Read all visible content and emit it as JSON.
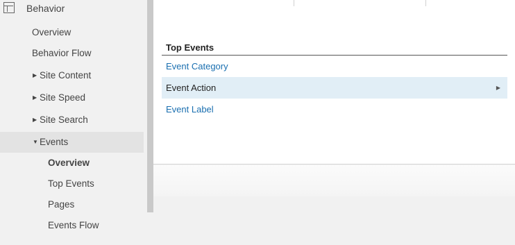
{
  "sidebar": {
    "section_title": "Behavior",
    "items": [
      {
        "label": "Overview"
      },
      {
        "label": "Behavior Flow"
      },
      {
        "label": "Site Content"
      },
      {
        "label": "Site Speed"
      },
      {
        "label": "Site Search"
      },
      {
        "label": "Events"
      }
    ],
    "events_subitems": [
      {
        "label": "Overview"
      },
      {
        "label": "Top Events"
      },
      {
        "label": "Pages"
      },
      {
        "label": "Events Flow"
      }
    ]
  },
  "main": {
    "table_title": "Top Events",
    "rows": [
      {
        "label": "Event Category"
      },
      {
        "label": "Event Action"
      },
      {
        "label": "Event Label"
      }
    ]
  },
  "colors": {
    "link": "#1a6fb0",
    "selected_row": "#e1eef6",
    "selected_nav": "#e3e3e3"
  },
  "icons": {
    "section": "layout-icon",
    "collapsed": "triangle-right-icon",
    "expanded": "triangle-down-icon",
    "row_expand": "triangle-right-icon"
  }
}
